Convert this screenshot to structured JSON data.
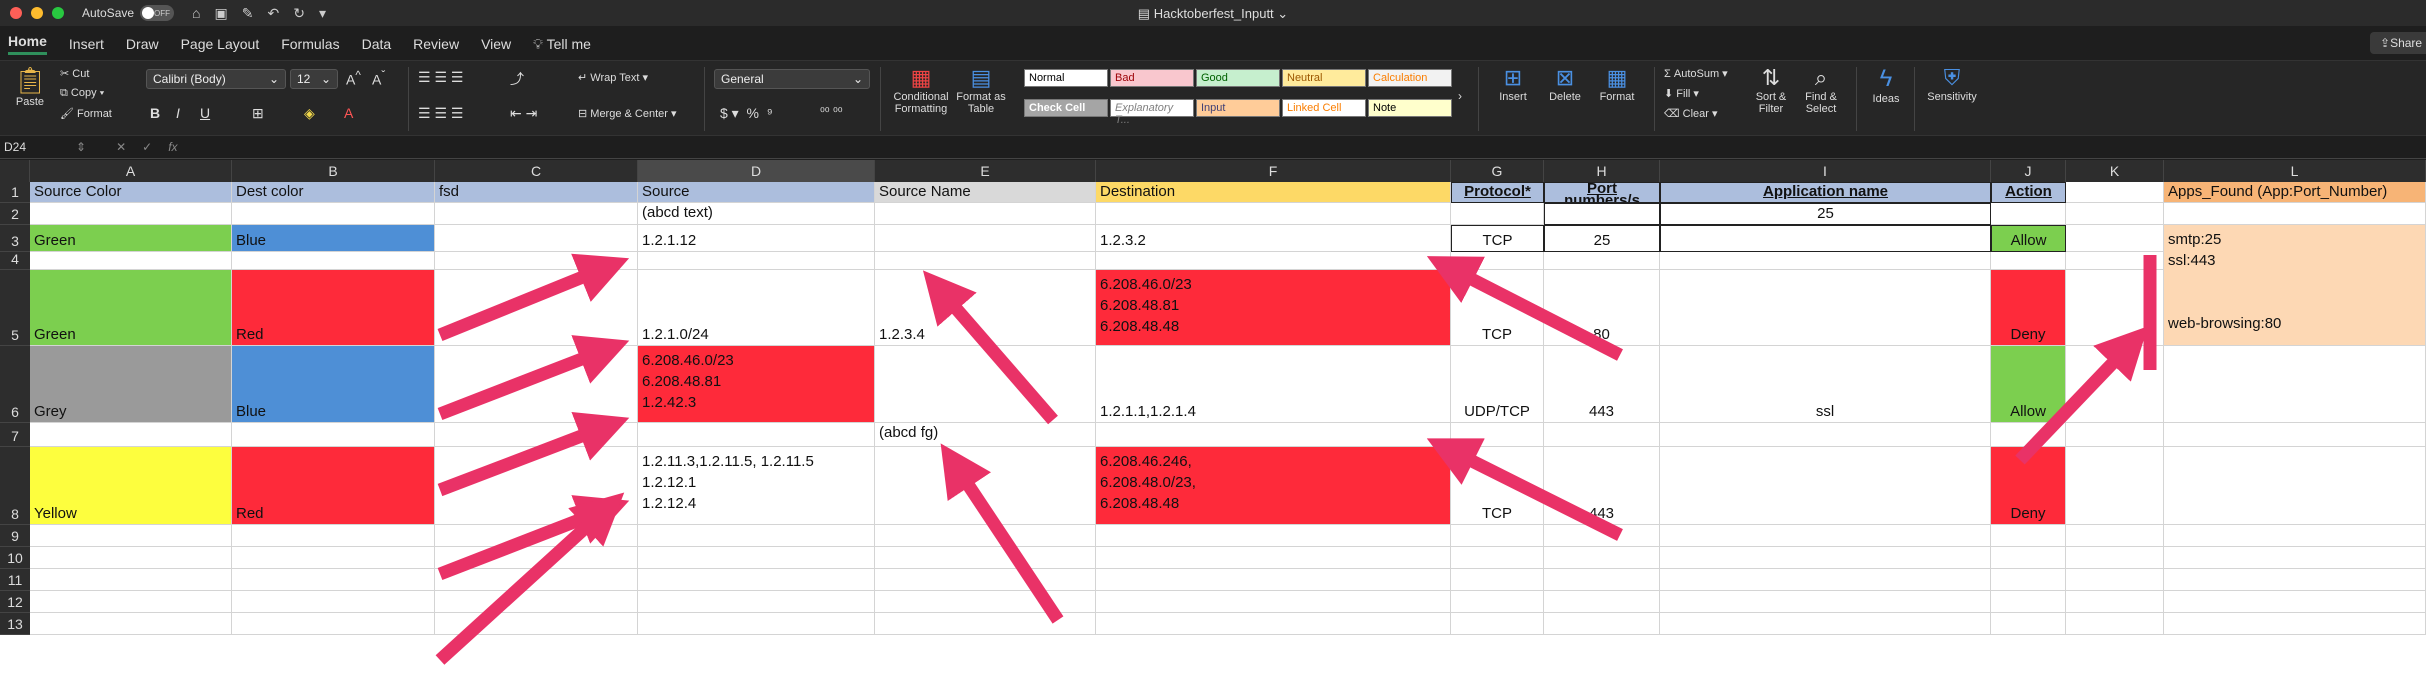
{
  "window": {
    "title": "Hacktoberfest_Inputt",
    "autosave_label": "AutoSave",
    "autosave_state": "OFF"
  },
  "tabs": [
    "Home",
    "Insert",
    "Draw",
    "Page Layout",
    "Formulas",
    "Data",
    "Review",
    "View",
    "Tell me"
  ],
  "share_label": "Share",
  "ribbon": {
    "paste": "Paste",
    "cut": "Cut",
    "copy": "Copy",
    "format_painter": "Format",
    "font_name": "Calibri (Body)",
    "font_size": "12",
    "wrap_text": "Wrap Text",
    "merge_center": "Merge & Center",
    "number_format": "General",
    "conditional_formatting": "Conditional Formatting",
    "format_as_table": "Format as Table",
    "styles": {
      "normal": "Normal",
      "bad": "Bad",
      "good": "Good",
      "neutral": "Neutral",
      "calculation": "Calculation",
      "check_cell": "Check Cell",
      "explanatory": "Explanatory T...",
      "input": "Input",
      "linked_cell": "Linked Cell",
      "note": "Note"
    },
    "insert": "Insert",
    "delete": "Delete",
    "format": "Format",
    "autosum": "AutoSum",
    "fill": "Fill",
    "clear": "Clear",
    "sort_filter": "Sort & Filter",
    "find_select": "Find & Select",
    "ideas": "Ideas",
    "sensitivity": "Sensitivity"
  },
  "formula_bar": {
    "name_box": "D24",
    "fx": "fx"
  },
  "columns": [
    "A",
    "B",
    "C",
    "D",
    "E",
    "F",
    "G",
    "H",
    "I",
    "J",
    "K",
    "L"
  ],
  "rows": [
    "1",
    "2",
    "3",
    "4",
    "5",
    "6",
    "7",
    "8",
    "9",
    "10",
    "11",
    "12",
    "13"
  ],
  "colors": {
    "header_blue": "#acbedd",
    "header_gray": "#d9d9d9",
    "header_yellow": "#fdd966",
    "green": "#7ccf4f",
    "blue": "#4e8fd6",
    "red": "#fe2a3a",
    "grey": "#9a9a9a",
    "yellow": "#fdfe3e",
    "peach": "#fdd8b4",
    "orange_header": "#f7b476",
    "arrow": "#e93267"
  },
  "cells": {
    "A1": "Source Color",
    "B1": "Dest color",
    "C1": "fsd",
    "D1": "Source",
    "E1": "Source Name",
    "F1": "Destination",
    "G1": "Protocol*",
    "H1": "Port numbers/s",
    "I1": "Application name",
    "J1": "Action",
    "L1": "Apps_Found (App:Port_Number)",
    "D2": "(abcd text)",
    "I2": "25",
    "A3": "Green",
    "B3": "Blue",
    "D3": "1.2.1.12",
    "F3": "1.2.3.2",
    "G3": "TCP",
    "H3": "25",
    "J3": "Allow",
    "L3": "smtp:25\nssl:443\n\n\nweb-browsing:80",
    "A5": "Green",
    "B5": "Red",
    "D5": "1.2.1.0/24",
    "E5": "1.2.3.4",
    "F5": "6.208.46.0/23\n6.208.48.81\n6.208.48.48",
    "G5": "TCP",
    "H5": "80",
    "J5": "Deny",
    "A6": "Grey",
    "B6": "Blue",
    "D6": "6.208.46.0/23\n6.208.48.81\n1.2.42.3",
    "F6": "1.2.1.1,1.2.1.4",
    "G6": "UDP/TCP",
    "H6": "443",
    "I6": "ssl",
    "J6": "Allow",
    "E7": "(abcd fg)",
    "A8": "Yellow",
    "B8": "Red",
    "D8": "1.2.11.3,1.2.11.5, 1.2.11.5\n1.2.12.1\n1.2.12.4",
    "F8": "6.208.46.246,\n6.208.48.0/23,\n6.208.48.48",
    "G8": "TCP",
    "H8": "443",
    "J8": "Deny"
  }
}
